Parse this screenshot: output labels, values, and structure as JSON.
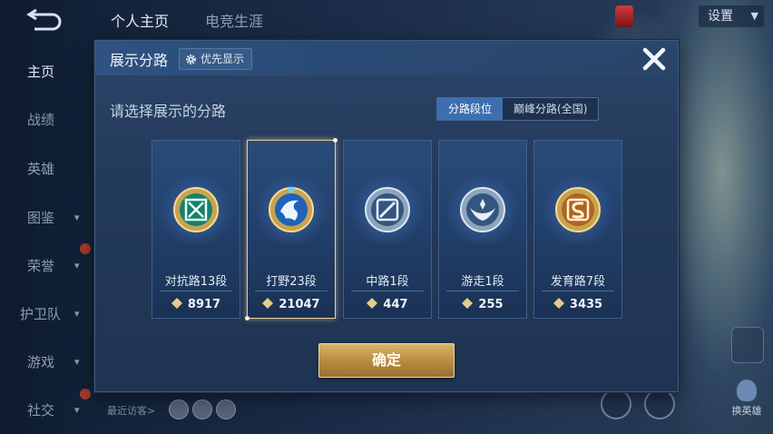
{
  "top": {
    "tabs": [
      "个人主页",
      "电竞生涯"
    ],
    "rank_text": "",
    "settings_label": "设置"
  },
  "sidebar": {
    "items": [
      {
        "label": "主页"
      },
      {
        "label": "战绩"
      },
      {
        "label": "英雄"
      },
      {
        "label": "图鉴"
      },
      {
        "label": "荣誉"
      },
      {
        "label": "护卫队"
      },
      {
        "label": "游戏"
      },
      {
        "label": "社交"
      }
    ]
  },
  "visitor_label": "最近访客>",
  "hero_switch_label": "换英雄",
  "dialog": {
    "title": "展示分路",
    "priority_button": "优先显示",
    "subtitle": "请选择展示的分路",
    "segments": [
      {
        "label": "分路段位",
        "active": true
      },
      {
        "label": "巅峰分路(全国)",
        "active": false
      }
    ],
    "lanes": [
      {
        "name": "对抗路13段",
        "score": "8917",
        "icon": "clash-lane-emblem-icon",
        "tier": "gold",
        "selected": false
      },
      {
        "name": "打野23段",
        "score": "21047",
        "icon": "jungle-emblem-icon",
        "tier": "gold",
        "selected": true
      },
      {
        "name": "中路1段",
        "score": "447",
        "icon": "mid-lane-emblem-icon",
        "tier": "silver",
        "selected": false
      },
      {
        "name": "游走1段",
        "score": "255",
        "icon": "roam-emblem-icon",
        "tier": "silver",
        "selected": false
      },
      {
        "name": "发育路7段",
        "score": "3435",
        "icon": "farm-lane-emblem-icon",
        "tier": "gold",
        "selected": false
      }
    ],
    "confirm_label": "确定"
  },
  "colors": {
    "accent_blue": "#3d6fb0",
    "gold": "#d7b46c",
    "selected_border": "#e8cf9c"
  }
}
